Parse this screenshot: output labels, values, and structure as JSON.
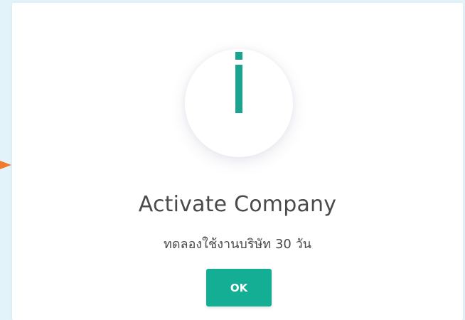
{
  "dialog": {
    "icon": "info-icon",
    "title": "Activate Company",
    "message": "ทดลองใช้งานบริษัท 30 วัน",
    "ok_label": "OK"
  },
  "colors": {
    "accent": "#14ae94",
    "icon": "#1aa38f",
    "text": "#4a4a4a",
    "backdrop": "#e3f3fa",
    "pointer": "#f27a2c"
  }
}
